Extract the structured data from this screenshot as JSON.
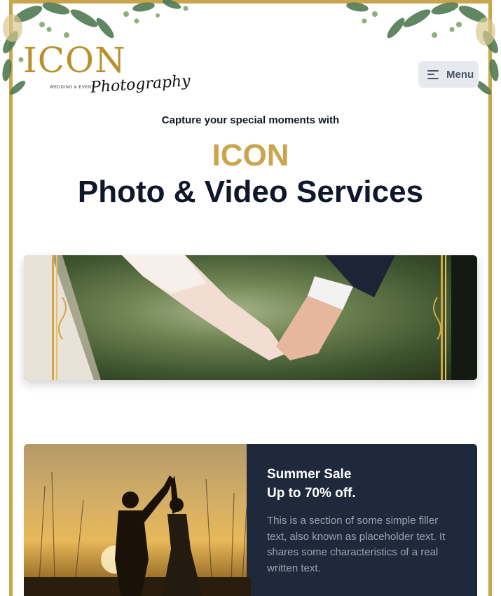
{
  "brand": {
    "logo_word": "ICON",
    "logo_sub": "WEDDING & EVENT",
    "logo_script": "Photography"
  },
  "header": {
    "menu_label": "Menu"
  },
  "hero": {
    "kicker": "Capture your special moments with",
    "brand": "ICON",
    "title": "Photo & Video Services"
  },
  "promo": {
    "title_line1": "Summer Sale",
    "title_line2": "Up to 70% off.",
    "text": "This is a section of some simple filler text, also known as placeholder text. It shares some characteristics of a real written text."
  },
  "colors": {
    "gold": "#c9a54e",
    "navy": "#1e293b",
    "heading": "#0f172a",
    "menu_bg": "#e7e9ee"
  }
}
